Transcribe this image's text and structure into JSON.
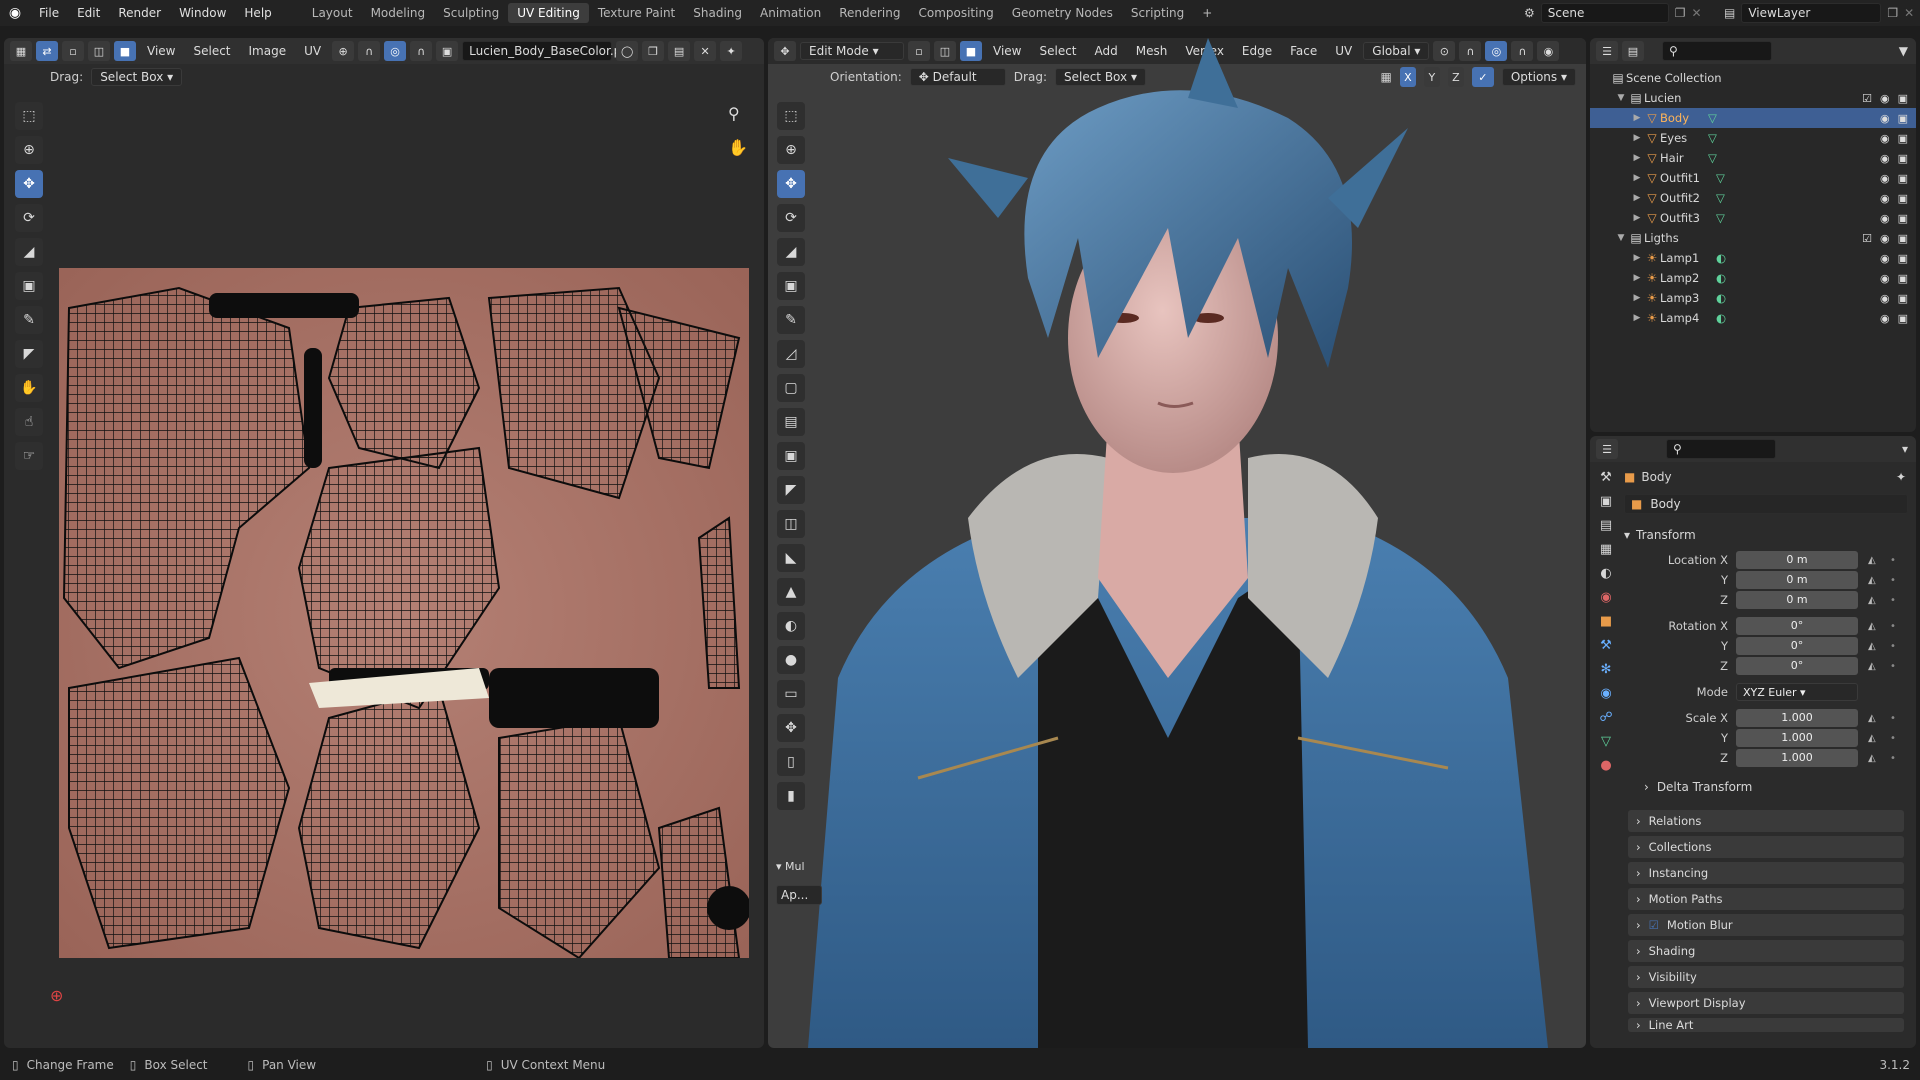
{
  "menubar": {
    "items": [
      "File",
      "Edit",
      "Render",
      "Window",
      "Help"
    ],
    "workspaces": [
      "Layout",
      "Modeling",
      "Sculpting",
      "UV Editing",
      "Texture Paint",
      "Shading",
      "Animation",
      "Rendering",
      "Compositing",
      "Geometry Nodes",
      "Scripting"
    ],
    "active_workspace": "UV Editing",
    "scene": "Scene",
    "view_layer": "ViewLayer"
  },
  "uv_editor": {
    "header_menus": [
      "View",
      "Select",
      "Image",
      "UV"
    ],
    "image_name": "Lucien_Body_BaseColor.png",
    "drag_label": "Drag:",
    "drag_value": "Select Box"
  },
  "viewport": {
    "mode": "Edit Mode",
    "header_menus": [
      "View",
      "Select",
      "Add",
      "Mesh",
      "Vertex",
      "Edge",
      "Face",
      "UV"
    ],
    "transform_space": "Global",
    "orientation_label": "Orientation:",
    "orientation_value": "Default",
    "drag_label": "Drag:",
    "drag_value": "Select Box",
    "axes": [
      "X",
      "Y",
      "Z"
    ],
    "options": "Options",
    "tool_panel_title": "Mul",
    "tool_panel_button": "Ap..."
  },
  "outliner": {
    "root": "Scene Collection",
    "collections": [
      {
        "name": "Lucien",
        "objects": [
          "Body",
          "Eyes",
          "Hair",
          "Outfit1",
          "Outfit2",
          "Outfit3"
        ]
      },
      {
        "name": "Ligths",
        "objects": [
          "Lamp1",
          "Lamp2",
          "Lamp3",
          "Lamp4"
        ]
      }
    ],
    "selected": "Body"
  },
  "properties": {
    "object_title": "Body",
    "object_name": "Body",
    "section": "Transform",
    "location": {
      "label": "Location X",
      "x": "0 m",
      "y": "0 m",
      "z": "0 m"
    },
    "rotation": {
      "label": "Rotation X",
      "x": "0°",
      "y": "0°",
      "z": "0°"
    },
    "mode_label": "Mode",
    "mode_value": "XYZ Euler",
    "scale": {
      "label": "Scale X",
      "x": "1.000",
      "y": "1.000",
      "z": "1.000"
    },
    "axis_y": "Y",
    "axis_z": "Z",
    "panels": [
      "Delta Transform",
      "Relations",
      "Collections",
      "Instancing",
      "Motion Paths",
      "Motion Blur",
      "Shading",
      "Visibility",
      "Viewport Display",
      "Line Art"
    ]
  },
  "statusbar": {
    "items": [
      "Change Frame",
      "Box Select",
      "Pan View",
      "UV Context Menu"
    ],
    "version": "3.1.2"
  },
  "colors": {
    "accent": "#4772b3",
    "uv_texture": "#b07868",
    "hair": "#3f6f98",
    "jacket": "#3a6a98"
  }
}
